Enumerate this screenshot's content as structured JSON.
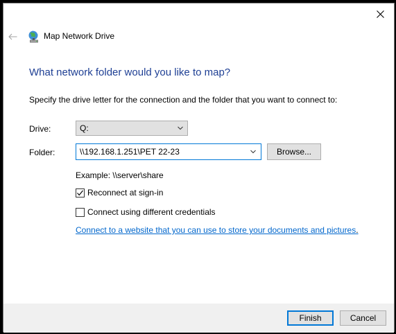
{
  "window": {
    "nav_title": "Map Network Drive"
  },
  "main": {
    "heading": "What network folder would you like to map?",
    "instruction": "Specify the drive letter for the connection and the folder that you want to connect to:",
    "drive": {
      "label": "Drive:",
      "value": "Q:"
    },
    "folder": {
      "label": "Folder:",
      "value": "\\\\192.168.1.251\\PET 22-23",
      "browse_label": "Browse..."
    },
    "example": "Example: \\\\server\\share",
    "reconnect": {
      "label": "Reconnect at sign-in",
      "checked": true
    },
    "credentials": {
      "label": "Connect using different credentials",
      "checked": false
    },
    "link": {
      "text": "Connect to a website that you can use to store your documents and pictures",
      "suffix": "."
    }
  },
  "footer": {
    "finish_label": "Finish",
    "cancel_label": "Cancel"
  },
  "icons": {
    "close": "close-icon",
    "back": "back-arrow-icon",
    "app": "network-drive-icon",
    "chevron": "chevron-down-icon",
    "check": "checkmark-icon"
  },
  "colors": {
    "heading": "#1e3f94",
    "link": "#0066cc",
    "focus": "#0078d7"
  }
}
